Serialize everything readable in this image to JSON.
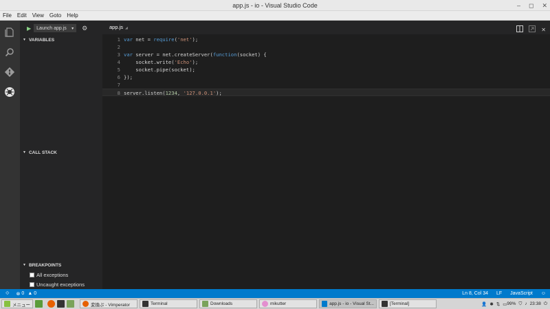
{
  "window": {
    "title": "app.js - io - Visual Studio Code"
  },
  "menu": [
    "File",
    "Edit",
    "View",
    "Goto",
    "Help"
  ],
  "debug": {
    "config": "Launch app.js"
  },
  "sidebar": {
    "variables": "VARIABLES",
    "call_stack": "CALL STACK",
    "breakpoints": "BREAKPOINTS",
    "bp_items": [
      "All exceptions",
      "Uncaught exceptions"
    ]
  },
  "editor": {
    "tab": "app.js"
  },
  "code": {
    "lines": [
      {
        "n": "1",
        "text": "var net = require('net');"
      },
      {
        "n": "2",
        "text": ""
      },
      {
        "n": "3",
        "text": "var server = net.createServer(function(socket) {"
      },
      {
        "n": "4",
        "text": "    socket.write('Echo');"
      },
      {
        "n": "5",
        "text": "    socket.pipe(socket);"
      },
      {
        "n": "6",
        "text": "});"
      },
      {
        "n": "7",
        "text": ""
      },
      {
        "n": "8",
        "text": "server.listen(1234, '127.0.0.1');"
      }
    ]
  },
  "status": {
    "errors": "0",
    "warnings": "0",
    "position": "Ln 8, Col 34",
    "eol": "LF",
    "language": "JavaScript"
  },
  "taskbar": {
    "menu": "メニュー",
    "tasks": [
      "変換ぷ - Vimperator",
      "Terminal",
      "Downloads",
      "mikutter",
      "app.js - io - Visual St...",
      "[Terminal]"
    ],
    "battery": "99%",
    "clock": "23:38"
  },
  "colors": {
    "accent": "#007acc",
    "keyword": "#569cd6",
    "string": "#ce9178",
    "number": "#b5cea8"
  }
}
